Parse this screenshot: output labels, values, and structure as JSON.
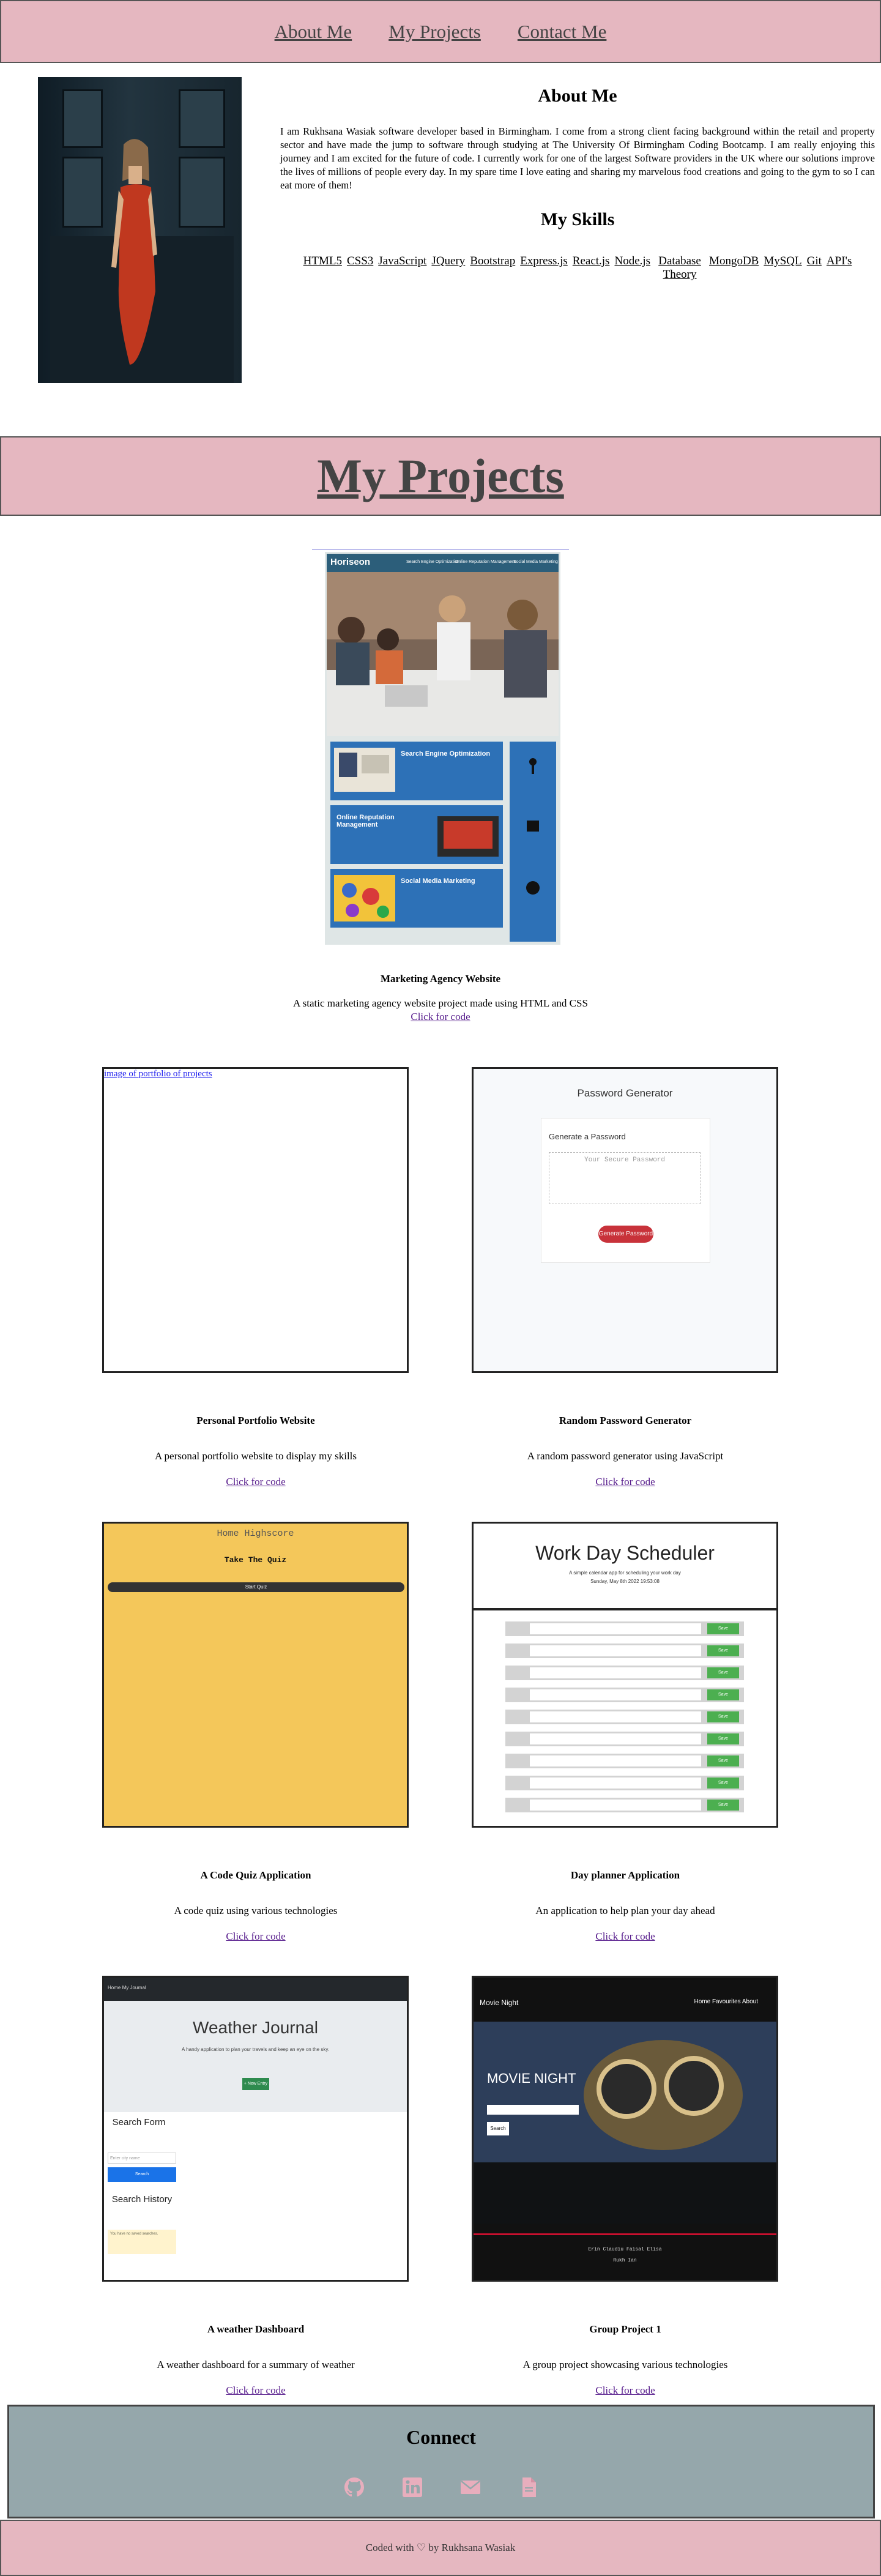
{
  "nav": {
    "links": [
      "About Me",
      "My Projects",
      "Contact Me"
    ]
  },
  "about": {
    "title": "About Me",
    "text": "I am Rukhsana Wasiak software developer based in Birmingham. I come from a strong client facing background within the retail and property sector and have made the jump to software through studying at The University Of Birmingham Coding Bootcamp. I am really enjoying this journey and I am excited for the future of code. I currently work for one of the largest Software providers in the UK where our solutions improve the lives of millions of people every day. In my spare time I love eating and sharing my marvelous food creations and going to the gym to so I can eat more of them!",
    "skills_title": "My Skills",
    "skills": [
      "HTML5",
      "CSS3",
      "JavaScript",
      "JQuery",
      "Bootstrap",
      "Express.js",
      "React.js",
      "Node.js",
      "Database Theory",
      "MongoDB",
      "MySQL",
      "Git",
      "API's"
    ]
  },
  "projects": {
    "title": "My Projects",
    "featured": {
      "screenshot": {
        "brand": "Horiseon",
        "nav": [
          "Search Engine Optimization",
          "Online Reputation Management",
          "Social Media Marketing"
        ],
        "cards": [
          "Search Engine Optimization",
          "Online Reputation Management",
          "Social Media Marketing"
        ]
      },
      "title": "Marketing Agency Website",
      "desc": "A static marketing agency website project made using HTML and CSS",
      "link": "Click for code"
    },
    "items": [
      {
        "title": "Personal Portfolio Website",
        "desc": "A personal portfolio website to display my skills",
        "link": "Click for code",
        "alt": "image of portfolio of projects"
      },
      {
        "title": "Random Password Generator",
        "desc": "A random password generator using JavaScript",
        "link": "Click for code",
        "screenshot": {
          "heading": "Password Generator",
          "sub": "Generate a Password",
          "placeholder": "Your Secure Password",
          "button": "Generate Password"
        }
      },
      {
        "title": "A Code Quiz Application",
        "desc": "A code quiz using various technologies",
        "link": "Click for code",
        "screenshot": {
          "top": "Home   Highscore",
          "heading": "Take The Quiz",
          "button": "Start Quiz"
        }
      },
      {
        "title": "Day planner Application",
        "desc": "An application to help plan your day ahead",
        "link": "Click for code",
        "screenshot": {
          "heading": "Work Day Scheduler",
          "sub": "A simple calendar app for scheduling your work day",
          "date": "Sunday, May 8th 2022 19:53:08",
          "save": "Save"
        }
      },
      {
        "title": "A weather Dashboard",
        "desc": "A weather dashboard for a summary of weather",
        "link": "Click for code",
        "screenshot": {
          "nav": "Home   My Journal",
          "heading": "Weather Journal",
          "sub": "A handy application to plan your travels and keep an eye on the sky.",
          "new": "+ New Entry",
          "search_title": "Search Form",
          "placeholder": "Enter city name",
          "search": "Search",
          "history": "Search History",
          "note": "You have no saved searches."
        }
      },
      {
        "title": "Group Project 1",
        "desc": "A group project showcasing various technologies",
        "link": "Click for code",
        "screenshot": {
          "brand": "Movie Night",
          "nav": "Home   Favourites   About",
          "heading": "MOVIE NIGHT",
          "search": "Search",
          "footer": "Erin   Claudiu   Faisal   Elisa",
          "footer2": "Rukh   Ian"
        }
      }
    ]
  },
  "connect": {
    "title": "Connect",
    "icons": [
      "github-icon",
      "linkedin-icon",
      "email-icon",
      "document-icon"
    ],
    "icon_color": "#e8aebd"
  },
  "footer": {
    "text": "Coded with ♡ by Rukhsana Wasiak"
  },
  "colors": {
    "pink": "#e5b7c0",
    "slate": "#95a7ab"
  }
}
